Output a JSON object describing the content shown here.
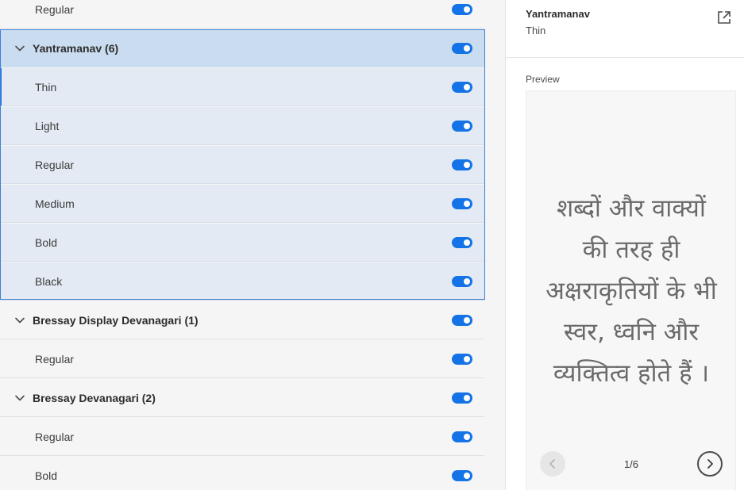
{
  "fonts_list": {
    "rows": [
      {
        "type": "style",
        "label": "Regular",
        "enabled": true
      },
      {
        "type": "family",
        "label": "Yantramanav (6)",
        "enabled": true,
        "expanded": true
      },
      {
        "type": "style",
        "label": "Thin",
        "enabled": true
      },
      {
        "type": "style",
        "label": "Light",
        "enabled": true
      },
      {
        "type": "style",
        "label": "Regular",
        "enabled": true
      },
      {
        "type": "style",
        "label": "Medium",
        "enabled": true
      },
      {
        "type": "style",
        "label": "Bold",
        "enabled": true
      },
      {
        "type": "style",
        "label": "Black",
        "enabled": true
      },
      {
        "type": "family",
        "label": "Bressay Display Devanagari (1)",
        "enabled": true,
        "expanded": true
      },
      {
        "type": "style",
        "label": "Regular",
        "enabled": true
      },
      {
        "type": "family",
        "label": "Bressay Devanagari (2)",
        "enabled": true,
        "expanded": true
      },
      {
        "type": "style",
        "label": "Regular",
        "enabled": true
      },
      {
        "type": "style",
        "label": "Bold",
        "enabled": true
      }
    ]
  },
  "details": {
    "font_name": "Yantramanav",
    "font_style": "Thin",
    "open_icon": "external-link-icon",
    "preview_label": "Preview",
    "preview_lines": [
      "शब्दों और वाक्यों",
      "की तरह ही",
      "अक्षराकृतियों के भी",
      "स्वर, ध्वनि और",
      "व्यक्तित्व होते हैं ।"
    ],
    "page_indicator": "1/6",
    "prev_icon": "chevron-left-icon",
    "next_icon": "chevron-right-icon"
  },
  "colors": {
    "accent": "#1473e6",
    "selected_group_bg": "#e3eaf3",
    "selected_family_bg": "#cadcf0"
  }
}
